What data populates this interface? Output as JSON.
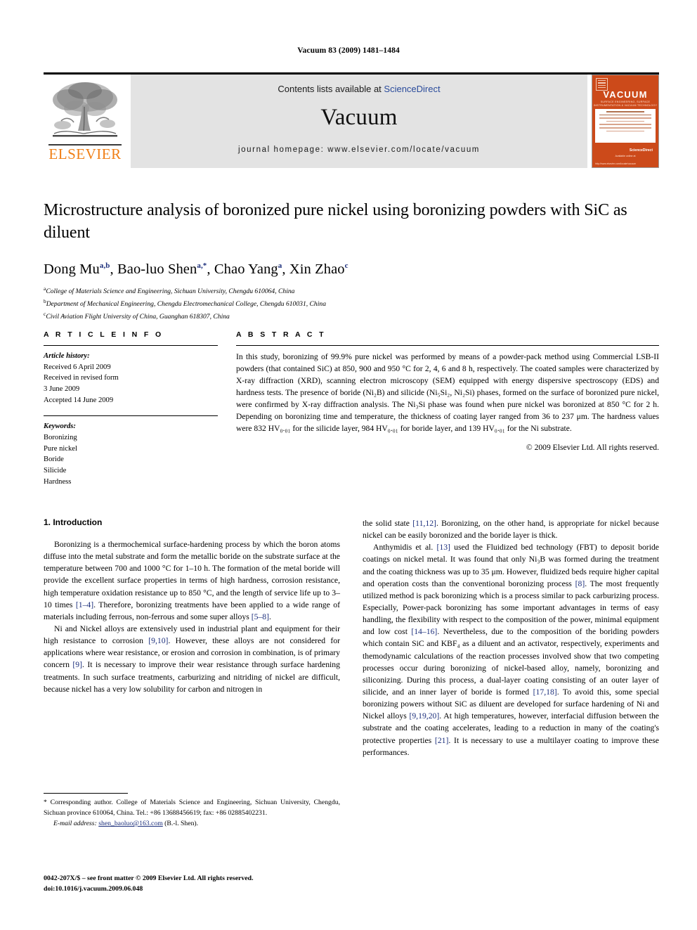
{
  "running_head": "Vacuum 83 (2009) 1481–1484",
  "masthead": {
    "publisher_name": "ELSEVIER",
    "contents_prefix": "Contents lists available at ",
    "contents_link": "ScienceDirect",
    "journal_name": "Vacuum",
    "homepage": "journal homepage: www.elsevier.com/locate/vacuum",
    "cover": {
      "title": "VACUUM",
      "subtitle": "SURFACE ENGINEERING, SURFACE INSTRUMENTATION & VACUUM TECHNOLOGY",
      "bottom_note": "Available online at",
      "science_direct": "ScienceDirect",
      "url": "http://www.elsevier.com/locate/vacuum"
    }
  },
  "accent_colors": {
    "elsevier_orange": "#F07F16",
    "cover_orange": "#CC4A1A",
    "link_blue": "#2a4b9b",
    "citation_blue": "#1c2f7c",
    "masthead_gray": "#e3e3e3"
  },
  "article": {
    "title": "Microstructure analysis of boronized pure nickel using boronizing powders with SiC as diluent",
    "authors": [
      {
        "name": "Dong Mu",
        "marks": "a,b"
      },
      {
        "name": "Bao-luo Shen",
        "marks": "a,*"
      },
      {
        "name": "Chao Yang",
        "marks": "a"
      },
      {
        "name": "Xin Zhao",
        "marks": "c"
      }
    ],
    "affiliations": [
      {
        "mark": "a",
        "text": "College of Materials Science and Engineering, Sichuan University, Chengdu 610064, China"
      },
      {
        "mark": "b",
        "text": "Department of Mechanical Engineering, Chengdu Electromechanical College, Chengdu 610031, China"
      },
      {
        "mark": "c",
        "text": "Civil Aviation Flight University of China, Guanghan 618307, China"
      }
    ]
  },
  "article_info": {
    "heading": "A R T I C L E   I N F O",
    "history_label": "Article history:",
    "history": [
      "Received 6 April 2009",
      "Received in revised form",
      "3 June 2009",
      "Accepted 14 June 2009"
    ],
    "keywords_label": "Keywords:",
    "keywords": [
      "Boronizing",
      "Pure nickel",
      "Boride",
      "Silicide",
      "Hardness"
    ]
  },
  "abstract": {
    "heading": "A B S T R A C T",
    "paragraphs": [
      "In this study, boronizing of 99.9% pure nickel was performed by means of a powder-pack method using Commercial LSB-II powders (that contained SiC) at 850, 900 and 950 °C for 2, 4, 6 and 8 h, respectively. The coated samples were characterized by X-ray diffraction (XRD), scanning electron microscopy (SEM) equipped with energy dispersive spectroscopy (EDS) and hardness tests. The presence of boride (Ni₂B) and silicide (Ni₅Si₂, Ni₂Si) phases, formed on the surface of boronized pure nickel, were confirmed by X-ray diffraction analysis. The Ni₃Si phase was found when pure nickel was boronized at 850 °C for 2 h. Depending on boronizing time and temperature, the thickness of coating layer ranged from 36 to 237 μm. The hardness values were 832 HV₀.₀₁ for the silicide layer, 984 HV₀.₀₁ for boride layer, and 139 HV₀.₀₁ for the Ni substrate."
    ],
    "copyright": "© 2009 Elsevier Ltd. All rights reserved."
  },
  "introduction": {
    "section_number_title": "1.  Introduction",
    "left_paragraphs": [
      "Boronizing is a thermochemical surface-hardening process by which the boron atoms diffuse into the metal substrate and form the metallic boride on the substrate surface at the temperature between 700 and 1000 °C for 1–10 h. The formation of the metal boride will provide the excellent surface properties in terms of high hardness, corrosion resistance, high temperature oxidation resistance up to 850 °C, and the length of service life up to 3–10 times [1–4]. Therefore, boronizing treatments have been applied to a wide range of materials including ferrous, non-ferrous and some super alloys [5–8].",
      "Ni and Nickel alloys are extensively used in industrial plant and equipment for their high resistance to corrosion [9,10]. However, these alloys are not considered for applications where wear resistance, or erosion and corrosion in combination, is of primary concern [9]. It is necessary to improve their wear resistance through surface hardening treatments. In such surface treatments, carburizing and nitriding of nickel are difficult, because nickel has a very low solubility for carbon and nitrogen in"
    ],
    "right_paragraphs": [
      "the solid state [11,12]. Boronizing, on the other hand, is appropriate for nickel because nickel can be easily boronized and the boride layer is thick.",
      "Anthymidis et al. [13] used the Fluidized bed technology (FBT) to deposit boride coatings on nickel metal. It was found that only Ni₃B was formed during the treatment and the coating thickness was up to 35 μm. However, fluidized beds require higher capital and operation costs than the conventional boronizing process [8]. The most frequently utilized method is pack boronizing which is a process similar to pack carburizing process. Especially, Power-pack boronizing has some important advantages in terms of easy handling, the flexibility with respect to the composition of the power, minimal equipment and low cost [14–16]. Nevertheless, due to the composition of the boriding powders which contain SiC and KBF₄ as a diluent and an activator, respectively, experiments and themodynamic calculations of the reaction processes involved show that two competing processes occur during boronizing of nickel-based alloy, namely, boronizing and siliconizing. During this process, a dual-layer coating consisting of an outer layer of silicide, and an inner layer of boride is formed [17,18]. To avoid this, some special boronizing powers without SiC as diluent are developed for surface hardening of Ni and Nickel alloys [9,19,20]. At high temperatures, however, interfacial diffusion between the substrate and the coating accelerates, leading to a reduction in many of the coating's protective properties [21]. It is necessary to use a multilayer coating to improve these performances."
    ]
  },
  "footnotes": {
    "corresponding": "* Corresponding author. College of Materials Science and Engineering, Sichuan University, Chengdu, Sichuan province 610064, China. Tel.: +86 13688456619; fax: +86 02885402231.",
    "email_label": "E-mail address:",
    "email": "shen_baoluo@163.com",
    "email_suffix": "(B.-l. Shen)."
  },
  "imprint": {
    "line1": "0042-207X/$ – see front matter © 2009 Elsevier Ltd. All rights reserved.",
    "line2": "doi:10.1016/j.vacuum.2009.06.048"
  }
}
